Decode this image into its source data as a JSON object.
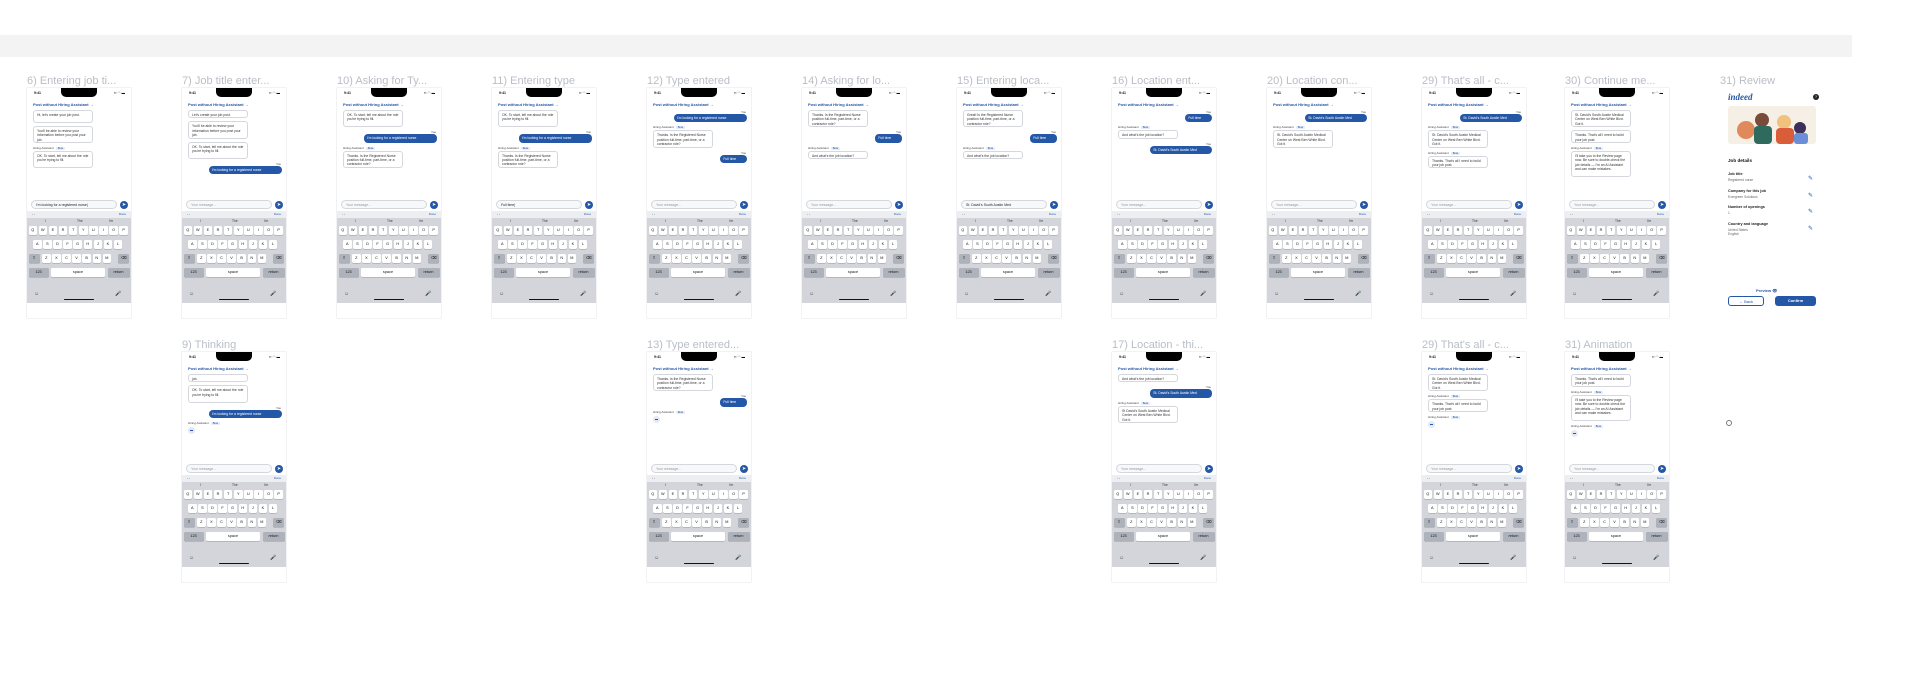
{
  "canvas_bar": "",
  "common": {
    "time": "9:41",
    "status_icons": "▪▪ ◠ ▬",
    "assistant_link": "Post without Hiring Assistant  →",
    "bot_name": "Hiring Assistant",
    "beta": "Beta",
    "you": "You",
    "send_icon": "➤",
    "kb_arrows": "‹   ›",
    "kb_done": "Done",
    "kb_suggestions": [
      "I",
      "The",
      "I'm"
    ],
    "kb_rows": [
      [
        "Q",
        "W",
        "E",
        "R",
        "T",
        "Y",
        "U",
        "I",
        "O",
        "P"
      ],
      [
        "A",
        "S",
        "D",
        "F",
        "G",
        "H",
        "J",
        "K",
        "L"
      ],
      [
        "Z",
        "X",
        "C",
        "V",
        "B",
        "N",
        "M"
      ]
    ],
    "kb_shift": "⇧",
    "kb_delete": "⌫",
    "kb_123": "123",
    "kb_space": "space",
    "kb_return": "return",
    "kb_emoji": "☺",
    "kb_mic": "🎤",
    "placeholder": "Your message..."
  },
  "frames": [
    {
      "title": "6) Entering job ti...",
      "bubbles": [
        {
          "kind": "bot",
          "text": "Hi, let's create your job post."
        },
        {
          "kind": "bot",
          "text": "You'll be able to review your information before you post your job."
        },
        {
          "kind": "bot",
          "text": "OK. To start, tell me about the role you're trying to fill."
        }
      ],
      "input": "I'm looking for a registered nurse|"
    },
    {
      "title": "7) Job title enter...",
      "bubbles": [
        {
          "kind": "bot",
          "text": "Let's create your job post."
        },
        {
          "kind": "bot",
          "text": "You'll be able to review your information before you post your job."
        },
        {
          "kind": "bot",
          "text": "OK. To start, tell me about the role you're trying to fill."
        },
        {
          "kind": "user",
          "text": "I'm looking for a registered nurse"
        }
      ],
      "input": ""
    },
    {
      "title": "10) Asking for Ty...",
      "bubbles": [
        {
          "kind": "bot",
          "text": "OK. To start, tell me about the role you're trying to fill."
        },
        {
          "kind": "user",
          "text": "I'm looking for a registered nurse"
        },
        {
          "kind": "bot",
          "text": "Thanks. Is the Registered Nurse position full-time, part-time, or a contractor role?"
        }
      ],
      "input": ""
    },
    {
      "title": "11) Entering type",
      "bubbles": [
        {
          "kind": "bot",
          "text": "OK. To start, tell me about the role you're trying to fill."
        },
        {
          "kind": "user",
          "text": "I'm looking for a registered nurse"
        },
        {
          "kind": "bot",
          "text": "Thanks. Is the Registered Nurse position full-time, part-time, or a contractor role?"
        }
      ],
      "input": "Full time|"
    },
    {
      "title": "12) Type entered",
      "bubbles": [
        {
          "kind": "user",
          "text": "I'm looking for a registered nurse"
        },
        {
          "kind": "bot",
          "text": "Thanks. Is the Registered Nurse position full-time, part-time, or a contractor role?"
        },
        {
          "kind": "user",
          "text": "Full time"
        }
      ],
      "input": ""
    },
    {
      "title": "14) Asking for lo...",
      "bubbles": [
        {
          "kind": "bot",
          "text": "Thanks. Is the Registered Nurse position full-time, part-time, or a contractor role?"
        },
        {
          "kind": "user",
          "text": "Full time"
        },
        {
          "kind": "bot",
          "text": "And what's the job location?"
        }
      ],
      "input": ""
    },
    {
      "title": "15) Entering loca...",
      "bubbles": [
        {
          "kind": "bot",
          "text": "Great! Is the Registered Nurse position full-time, part-time, or a contractor role?"
        },
        {
          "kind": "user",
          "text": "Full time"
        },
        {
          "kind": "bot",
          "text": "And what's the job location?"
        }
      ],
      "input": "St. David's South Austin Med"
    },
    {
      "title": "16) Location ent...",
      "bubbles": [
        {
          "kind": "user",
          "text": "Full time"
        },
        {
          "kind": "bot",
          "text": "And what's the job location?"
        },
        {
          "kind": "user",
          "text": "St. David's South Austin Med"
        }
      ],
      "input": ""
    },
    {
      "title": "20) Location con...",
      "bubbles": [
        {
          "kind": "user",
          "text": "St. David's South Austin Med"
        },
        {
          "kind": "bot",
          "text": "St. David's South Austin Medical Center on West Ben White Blvd. Got it."
        }
      ],
      "input": ""
    },
    {
      "title": "29) That's all - c...",
      "bubbles": [
        {
          "kind": "user",
          "text": "St. David's South Austin Med"
        },
        {
          "kind": "bot",
          "text": "St. David's South Austin Medical Center on West Ben White Blvd. Got it."
        },
        {
          "kind": "bot",
          "text": "Thanks. That's all I need to build your job post."
        }
      ],
      "input": ""
    },
    {
      "title": "30) Continue me...",
      "bubbles": [
        {
          "kind": "bot",
          "text": "St. David's South Austin Medical Center on West Ben White Blvd. Got it."
        },
        {
          "kind": "bot",
          "text": "Thanks. That's all I need to build your job post."
        },
        {
          "kind": "bot",
          "text": "I'll take you to the Review page now. Be sure to double-check the job details — I'm an AI Assistant and can make mistakes."
        }
      ],
      "input": ""
    },
    {
      "title": "9) Thinking",
      "bubbles": [
        {
          "kind": "bot",
          "text": "job."
        },
        {
          "kind": "bot",
          "text": "OK. To start, tell me about the role you're trying to fill."
        },
        {
          "kind": "user",
          "text": "I'm looking for a registered nurse"
        }
      ],
      "thinking": true,
      "input": ""
    },
    {
      "title": "13) Type entered...",
      "bubbles": [
        {
          "kind": "bot",
          "text": "Thanks. Is the Registered Nurse position full-time, part-time, or a contractor role?"
        },
        {
          "kind": "user",
          "text": "Full time"
        }
      ],
      "thinking": true,
      "input": ""
    },
    {
      "title": "17) Location - thi...",
      "bubbles": [
        {
          "kind": "bot",
          "text": "And what's the job location?"
        },
        {
          "kind": "user",
          "text": "St. David's South Austin Med"
        },
        {
          "kind": "bot",
          "text": "St David's South Austin Medical Center on West Ben White Blvd. Got it."
        }
      ],
      "input": ""
    },
    {
      "title": "29) That's all - c...",
      "bubbles": [
        {
          "kind": "bot",
          "text": "St. David's South Austin Medical Center on West Ben White Blvd. Got it."
        },
        {
          "kind": "bot",
          "text": "Thanks. That's all I need to build your job post."
        }
      ],
      "thinking": true,
      "input": ""
    },
    {
      "title": "31) Animation",
      "bubbles": [
        {
          "kind": "bot",
          "text": "Thanks. That's all I need to build your job post."
        },
        {
          "kind": "bot",
          "text": "I'll take you to the Review page now. Be sure to double-check the job details — I'm an AI Assistant and can make mistakes."
        }
      ],
      "thinking": true,
      "input": ""
    }
  ],
  "review": {
    "title": "31) Review",
    "logo": "indeed",
    "help": "?",
    "section": "Job details",
    "fields": [
      {
        "label": "Job title",
        "value": "Registered nurse"
      },
      {
        "label": "Company for this job",
        "value": "Evergreen Solutions"
      },
      {
        "label": "Number of openings",
        "value": "1"
      },
      {
        "label": "Country and language",
        "value": "United States\nEnglish"
      }
    ],
    "edit_icon": "✎",
    "preview": "Preview  👁",
    "back": "←  Back",
    "confirm": "Confirm"
  }
}
